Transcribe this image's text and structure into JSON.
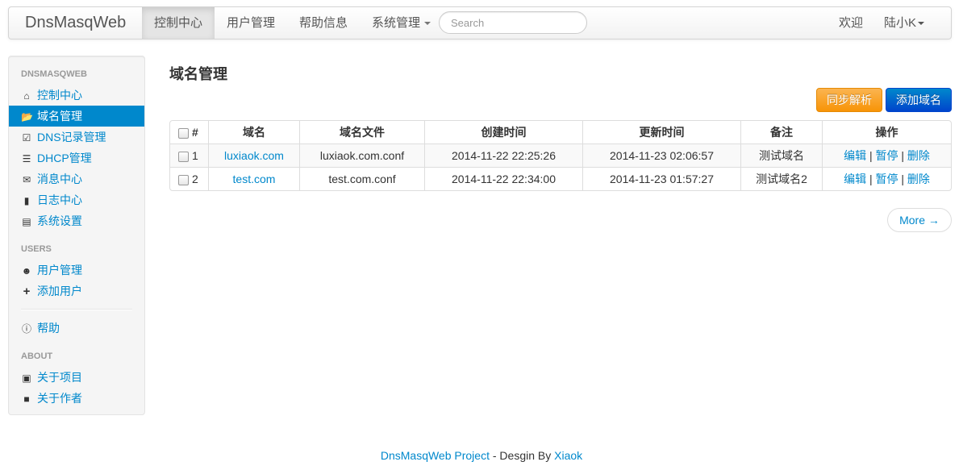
{
  "navbar": {
    "brand": "DnsMasqWeb",
    "items": [
      {
        "label": "控制中心",
        "active": true
      },
      {
        "label": "用户管理"
      },
      {
        "label": "帮助信息"
      },
      {
        "label": "系统管理"
      }
    ],
    "search_placeholder": "Search",
    "welcome": "欢迎",
    "user": "陆小K"
  },
  "sidebar": {
    "headers": [
      "DNSMASQWEB",
      "USERS",
      "ABOUT"
    ],
    "items": [
      {
        "label": "控制中心",
        "icon": "home-icon"
      },
      {
        "label": "域名管理",
        "icon": "folder-open-icon",
        "active": true
      },
      {
        "label": "DNS记录管理",
        "icon": "check-icon"
      },
      {
        "label": "DHCP管理",
        "icon": "list-icon"
      },
      {
        "label": "消息中心",
        "icon": "envelope-icon"
      },
      {
        "label": "日志中心",
        "icon": "file-icon"
      },
      {
        "label": "系统设置",
        "icon": "list-alt-icon"
      },
      {
        "label": "用户管理",
        "icon": "user-icon"
      },
      {
        "label": "添加用户",
        "icon": "plus-icon"
      },
      {
        "label": "帮助",
        "icon": "info-icon"
      },
      {
        "label": "关于项目",
        "icon": "picture-icon"
      },
      {
        "label": "关于作者",
        "icon": "stop-icon"
      }
    ]
  },
  "main": {
    "title": "域名管理",
    "sync_button": "同步解析",
    "add_button": "添加域名",
    "table": {
      "headers": [
        "#",
        "域名",
        "域名文件",
        "创建时间",
        "更新时间",
        "备注",
        "操作"
      ],
      "rows": [
        {
          "id": "1",
          "domain": "luxiaok.com",
          "file": "luxiaok.com.conf",
          "created": "2014-11-22 22:25:26",
          "updated": "2014-11-23 02:06:57",
          "note": "测试域名"
        },
        {
          "id": "2",
          "domain": "test.com",
          "file": "test.com.conf",
          "created": "2014-11-22 22:34:00",
          "updated": "2014-11-23 01:57:27",
          "note": "测试域名2"
        }
      ],
      "actions": {
        "edit": "编辑",
        "pause": "暂停",
        "delete": "删除",
        "sep": "|"
      }
    },
    "more": "More →"
  },
  "footer": {
    "project": "DnsMasqWeb Project",
    "middle": " - Desgin By ",
    "author": "Xiaok"
  }
}
